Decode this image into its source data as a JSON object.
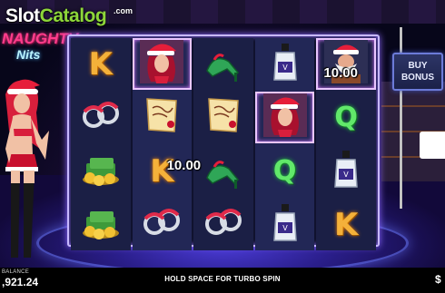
{
  "watermark": {
    "brand_a": "Slot",
    "brand_b": "Catalog",
    "suffix": ".com"
  },
  "game_title": {
    "line1": "NAUGHTY",
    "line2": "Nits"
  },
  "reels": [
    [
      "K",
      "handcuffs",
      "money",
      "money"
    ],
    [
      "santa-girl",
      "naughty-note",
      "K",
      "handcuffs"
    ],
    [
      "heels",
      "naughty-note",
      "heels",
      "handcuffs"
    ],
    [
      "bottle",
      "santa-girl",
      "Q",
      "bottle"
    ],
    [
      "santa-man",
      "Q",
      "bottle",
      "K"
    ]
  ],
  "win_values": [
    {
      "label": "10.00",
      "reel": 4,
      "row": 0
    },
    {
      "label": "10.00",
      "reel": 1,
      "row": 2
    }
  ],
  "buttons": {
    "buy_bonus_line1": "BUY",
    "buy_bonus_line2": "BONUS"
  },
  "bottom": {
    "balance_label": "BALANCE",
    "balance_value": ",921.24",
    "hint": "HOLD SPACE FOR TURBO SPIN",
    "currency_symbol": "$"
  },
  "colors": {
    "frame": "#c7b8ff",
    "letter_k": "#f4b13a",
    "letter_q": "#61e86a",
    "accent_pink": "#ff3d8c"
  }
}
